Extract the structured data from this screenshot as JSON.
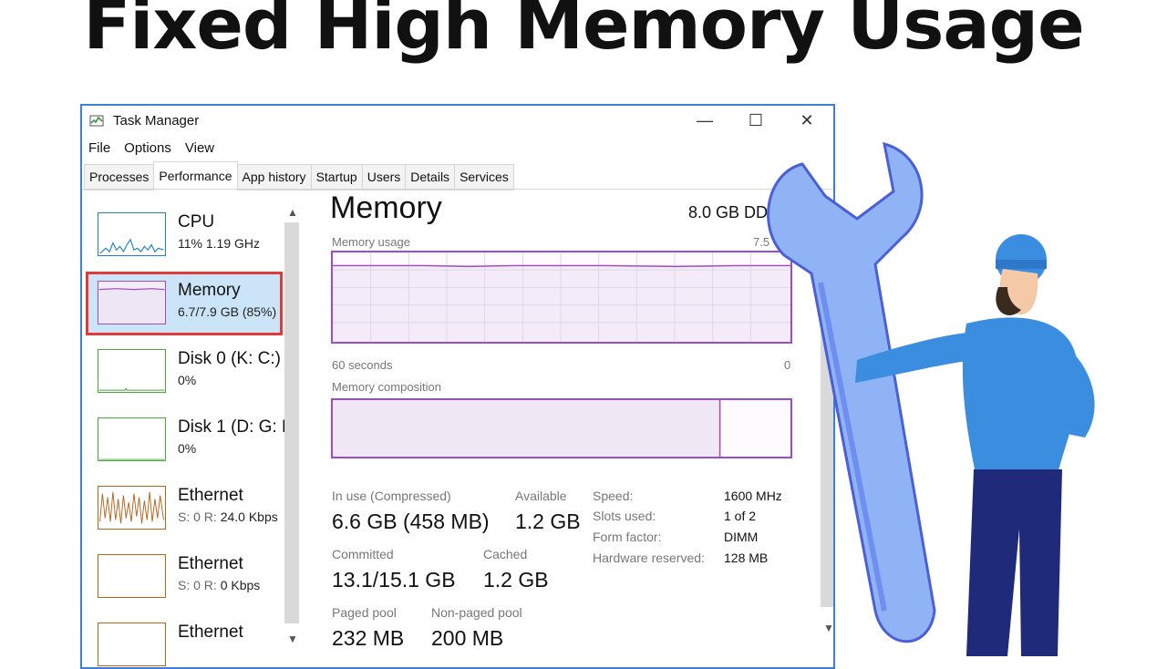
{
  "headline": "Fixed High Memory Usage",
  "window": {
    "title": "Task Manager",
    "controls": {
      "minimize": "—",
      "maximize": "☐",
      "close": "✕"
    }
  },
  "menu": [
    "File",
    "Options",
    "View"
  ],
  "tabs": [
    "Processes",
    "Performance",
    "App history",
    "Startup",
    "Users",
    "Details",
    "Services"
  ],
  "active_tab": "Performance",
  "resources": [
    {
      "name": "CPU",
      "value": "11%  1.19 GHz",
      "color": "#1f82c9"
    },
    {
      "name": "Memory",
      "value": "6.7/7.9 GB (85%)",
      "color": "#9b4cc8",
      "selected": true
    },
    {
      "name": "Disk 0 (K: C:)",
      "value": "0%",
      "color": "#4aa83c"
    },
    {
      "name": "Disk 1 (D: G: H",
      "value": "0%",
      "color": "#4aa83c"
    },
    {
      "name": "Ethernet",
      "value_label": "S: 0 R:",
      "value": "24.0 Kbps",
      "color": "#b5651d"
    },
    {
      "name": "Ethernet",
      "value_label": "S: 0 R:",
      "value": "0 Kbps",
      "color": "#b5651d"
    },
    {
      "name": "Ethernet",
      "value": "",
      "color": "#b5651d"
    }
  ],
  "memory": {
    "title": "Memory",
    "total": "8.0 GB DD",
    "usage_label": "Memory usage",
    "usage_max": "7.5",
    "time_label": "60 seconds",
    "time_end": "0",
    "composition_label": "Memory composition",
    "stats": {
      "in_use_label": "In use (Compressed)",
      "in_use": "6.6 GB (458 MB)",
      "available_label": "Available",
      "available": "1.2 GB",
      "committed_label": "Committed",
      "committed": "13.1/15.1 GB",
      "cached_label": "Cached",
      "cached": "1.2 GB",
      "paged_label": "Paged pool",
      "paged": "232 MB",
      "nonpaged_label": "Non-paged pool",
      "nonpaged": "200 MB"
    },
    "specs": [
      {
        "label": "Speed:",
        "value": "1600 MHz"
      },
      {
        "label": "Slots used:",
        "value": "1 of 2"
      },
      {
        "label": "Form factor:",
        "value": "DIMM"
      },
      {
        "label": "Hardware reserved:",
        "value": "128 MB"
      }
    ]
  },
  "colors": {
    "memory": "#9b4cc8",
    "window_border": "#3d7fd9",
    "selection_outline": "#e03b3b",
    "selection_bg": "#cce4f7"
  }
}
